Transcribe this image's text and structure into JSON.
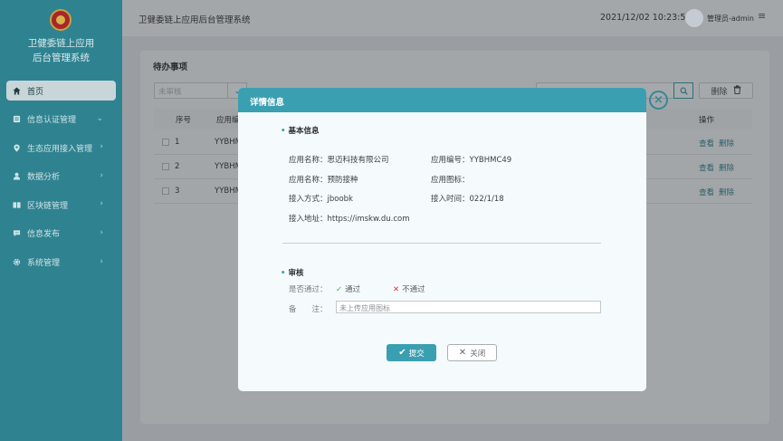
{
  "brand": {
    "line1": "卫健委链上应用",
    "line2": "后台管理系统"
  },
  "sidebar": {
    "items": [
      {
        "label": "首页",
        "icon": "home-icon"
      },
      {
        "label": "信息认证管理",
        "icon": "id-card-icon"
      },
      {
        "label": "生态应用接入管理",
        "icon": "location-icon"
      },
      {
        "label": "数据分析",
        "icon": "user-icon"
      },
      {
        "label": "区块链管理",
        "icon": "book-icon"
      },
      {
        "label": "信息发布",
        "icon": "message-icon"
      },
      {
        "label": "系统管理",
        "icon": "gear-icon"
      }
    ]
  },
  "header": {
    "title": "卫健委链上应用后台管理系统",
    "datetime": "2021/12/02 10:23:57",
    "user": "管理员-admin"
  },
  "main": {
    "title": "待办事项",
    "filter_placeholder": "未审核",
    "delete_label": "删除",
    "columns": {
      "index": "序号",
      "code": "应用编",
      "ops": "操作"
    },
    "rows": [
      {
        "index": "1",
        "code": "YYBHM",
        "view": "查看",
        "del": "删除"
      },
      {
        "index": "2",
        "code": "YYBHM",
        "view": "查看",
        "del": "删除"
      },
      {
        "index": "3",
        "code": "YYBHM",
        "view": "查看",
        "del": "删除"
      }
    ]
  },
  "modal": {
    "title": "详情信息",
    "basic_section": "基本信息",
    "fields": {
      "name1": "应用名称：思迈科技有限公司",
      "name2": "应用名称：预防接种",
      "access_method": "接入方式：jboobk",
      "access_url": "接入地址：https://imskw.du.com",
      "app_code": "应用编号：YYBHMC49",
      "app_icon": "应用图标：",
      "access_time": "接入时间：022/1/18"
    },
    "review_section": "审核",
    "pass_label": "是否通过：",
    "pass_option": "通过",
    "fail_option": "不通过",
    "remark_label": "备　　注：",
    "remark_value": "未上传应用图标",
    "submit_label": "提交",
    "cancel_label": "关闭"
  },
  "colors": {
    "accent": "#3a9fb0",
    "sidebar": "#2f8391"
  }
}
